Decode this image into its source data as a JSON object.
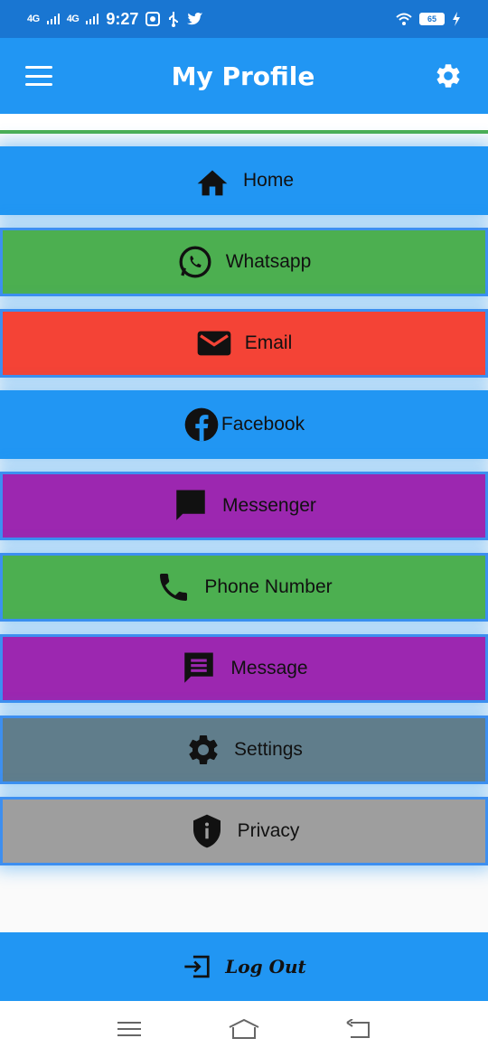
{
  "status_bar": {
    "sig1": "4G",
    "sig2": "4G",
    "time": "9:27",
    "battery": "65"
  },
  "appbar": {
    "title": "My Profile"
  },
  "menu": [
    {
      "label": "Home",
      "icon": "home-icon",
      "bg": "#2196f3"
    },
    {
      "label": "Whatsapp",
      "icon": "whatsapp-icon",
      "bg": "#4caf50"
    },
    {
      "label": "Email",
      "icon": "email-icon",
      "bg": "#f44336"
    },
    {
      "label": "Facebook",
      "icon": "facebook-icon",
      "bg": "#2196f3"
    },
    {
      "label": "Messenger",
      "icon": "chat-icon",
      "bg": "#9c27b0"
    },
    {
      "label": "Phone Number",
      "icon": "phone-icon",
      "bg": "#4caf50"
    },
    {
      "label": "Message",
      "icon": "message-icon",
      "bg": "#9c27b0"
    },
    {
      "label": "Settings",
      "icon": "gear-icon",
      "bg": "#607d8b"
    },
    {
      "label": "Privacy",
      "icon": "shield-info-icon",
      "bg": "#9e9e9e"
    }
  ],
  "logout": {
    "label": "Log Out"
  }
}
